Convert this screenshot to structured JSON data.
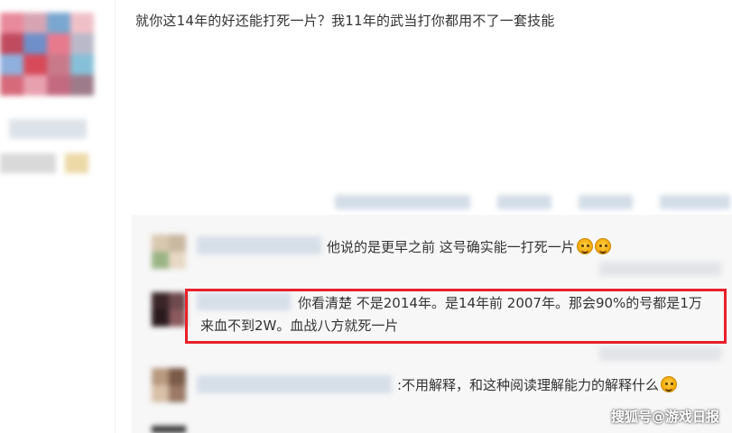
{
  "post": {
    "text": "就你这14年的好还能打死一片？我11年的武当打你都用不了一套技能"
  },
  "replies": [
    {
      "text": "他说的是更早之前 这号确实能一打死一片",
      "emoji": [
        "angry-face-emoji",
        "angry-face-emoji"
      ]
    },
    {
      "line1": "你看清楚 不是2014年。是14年前 2007年。那会90%的号都是1万",
      "line2": "来血不到2W。血战八方就死一片",
      "highlighted": true
    },
    {
      "text": ":不用解释，和这种阅读理解能力的解释什么",
      "emoji": [
        "smile-face-emoji"
      ]
    }
  ],
  "watermark": "搜狐号@游戏日报",
  "colors": {
    "highlight": "#e8202a",
    "reply_panel_bg": "#f7f7f7",
    "text": "#333333"
  }
}
